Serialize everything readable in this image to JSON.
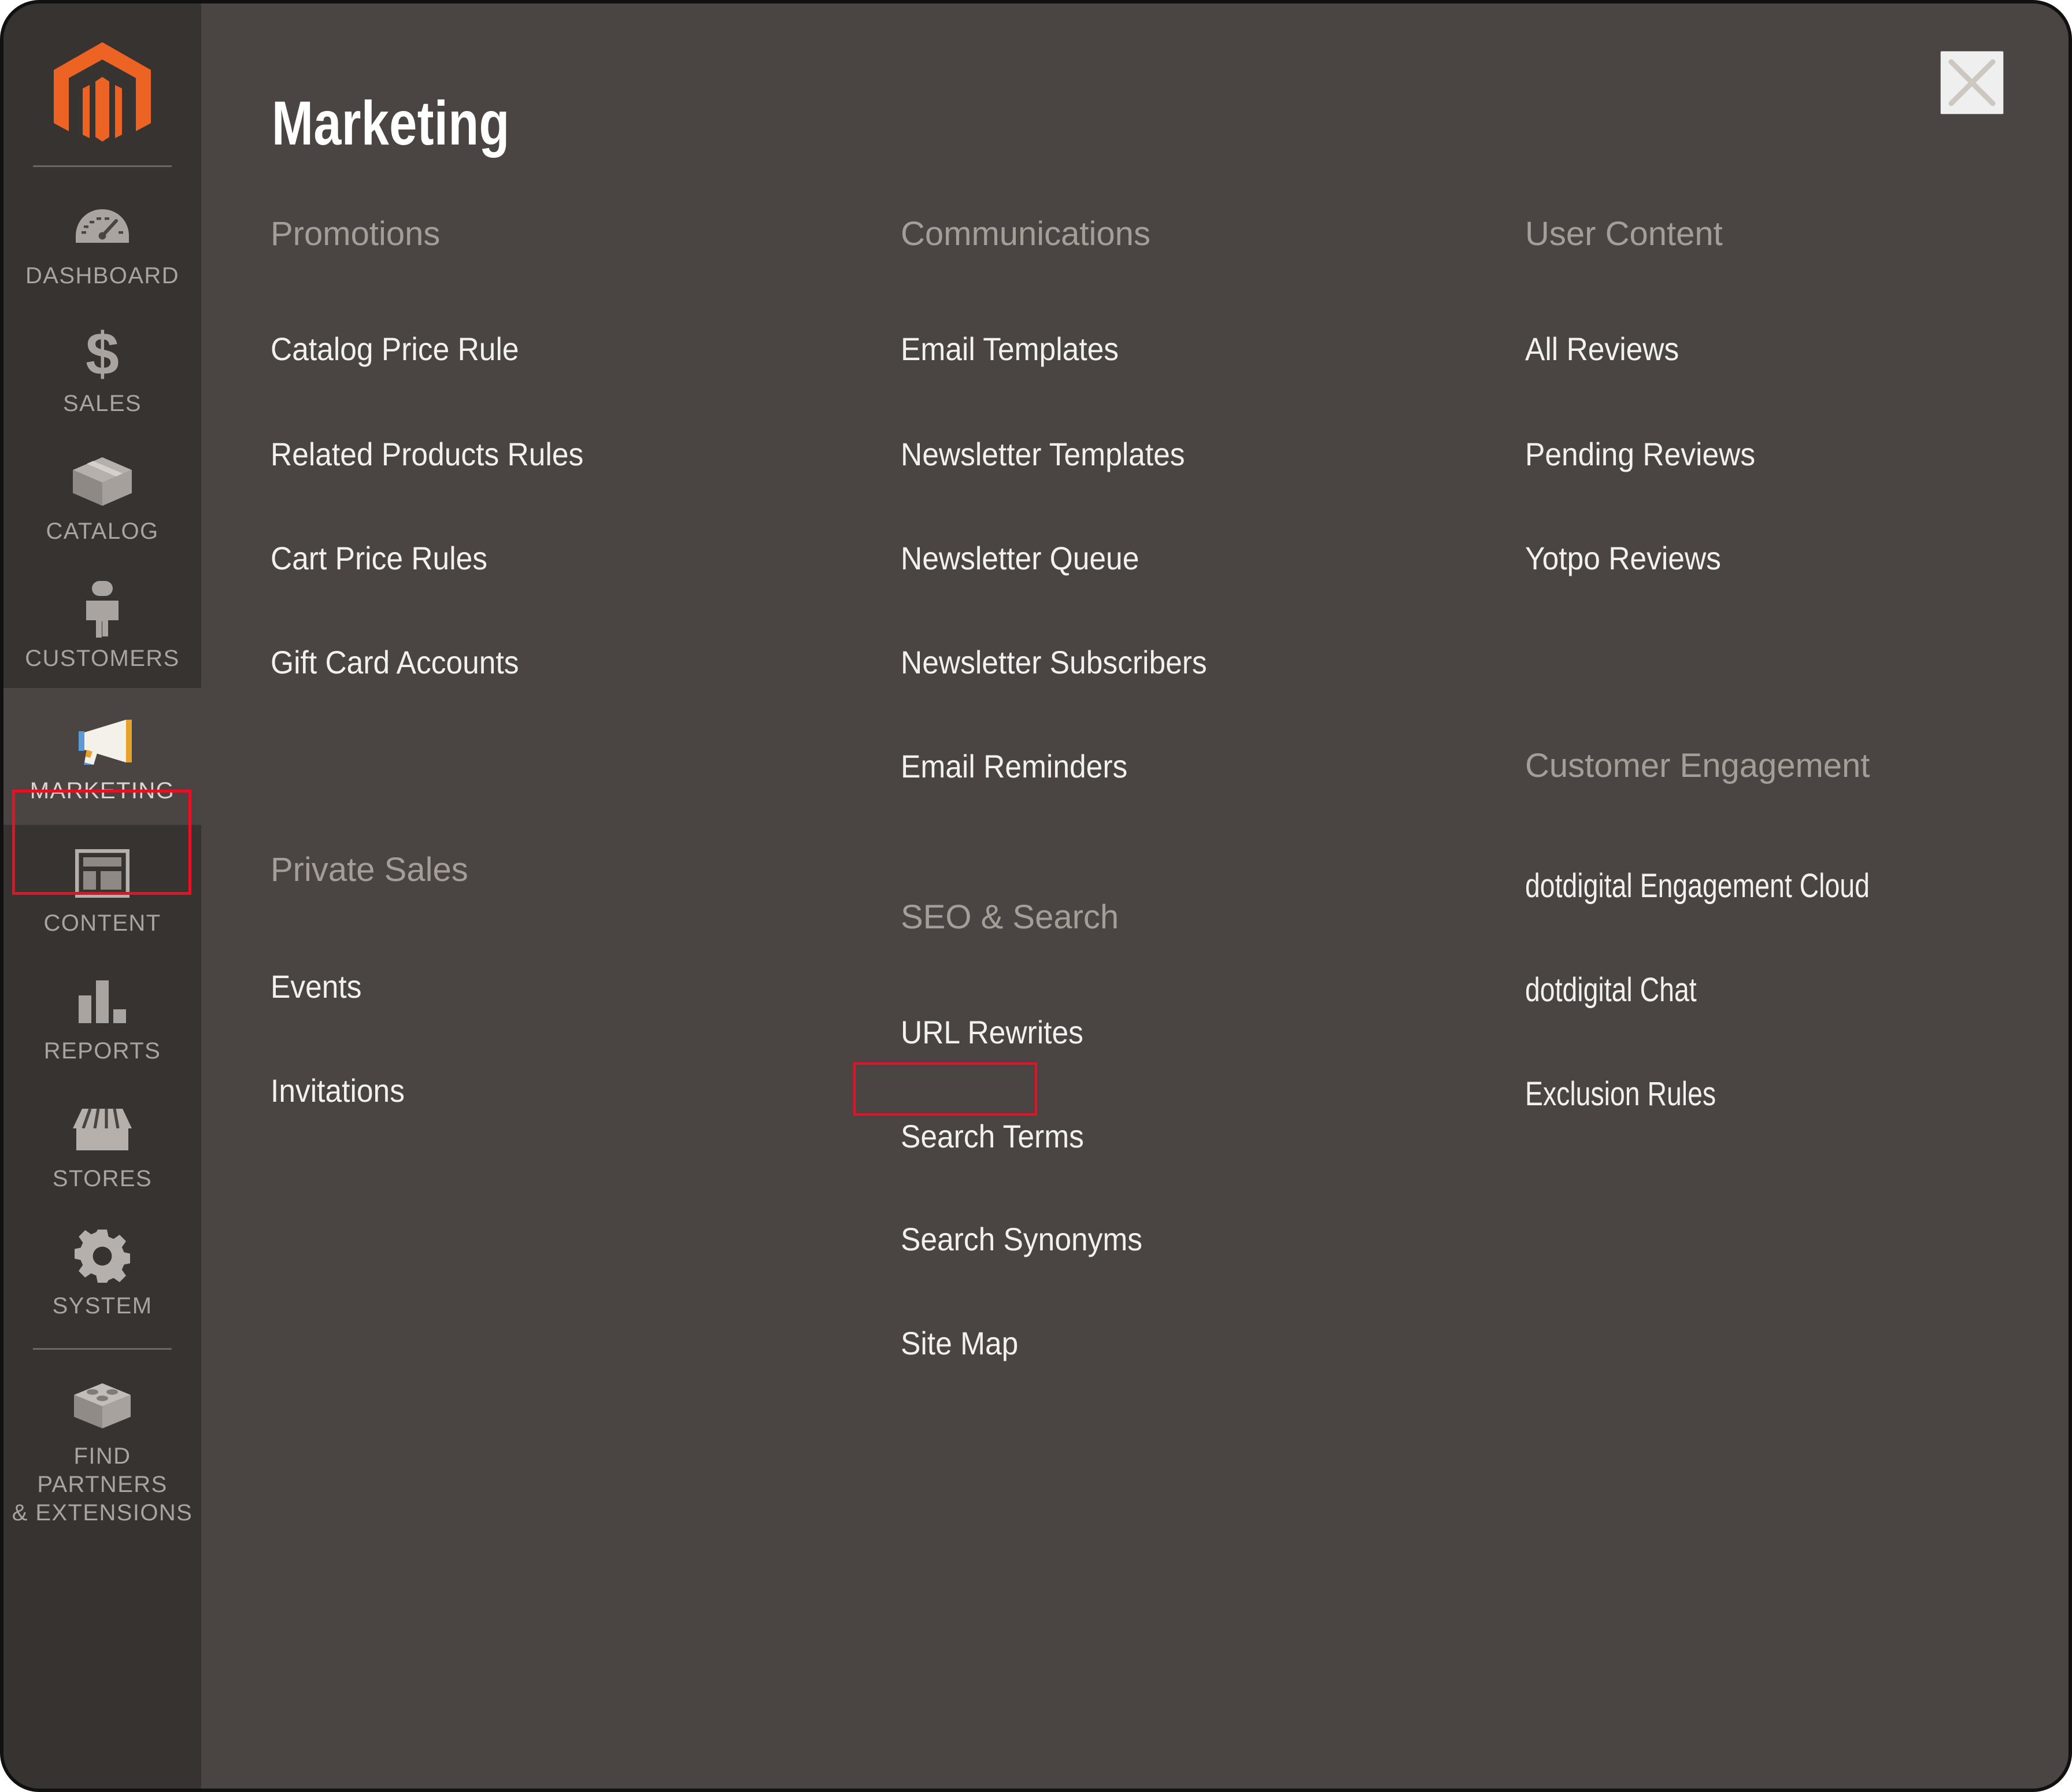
{
  "panel": {
    "title": "Marketing",
    "close_icon": "close-icon"
  },
  "sidebar": {
    "logo_icon": "magento-logo-icon",
    "items": [
      {
        "label": "DASHBOARD",
        "icon": "gauge-icon",
        "active": false
      },
      {
        "label": "SALES",
        "icon": "dollar-icon",
        "active": false
      },
      {
        "label": "CATALOG",
        "icon": "box-icon",
        "active": false
      },
      {
        "label": "CUSTOMERS",
        "icon": "person-icon",
        "active": false
      },
      {
        "label": "MARKETING",
        "icon": "megaphone-icon",
        "active": true
      },
      {
        "label": "CONTENT",
        "icon": "layout-icon",
        "active": false
      },
      {
        "label": "REPORTS",
        "icon": "bar-chart-icon",
        "active": false
      },
      {
        "label": "STORES",
        "icon": "storefront-icon",
        "active": false
      },
      {
        "label": "SYSTEM",
        "icon": "gear-icon",
        "active": false
      },
      {
        "label": "FIND PARTNERS\n& EXTENSIONS",
        "icon": "brick-icon",
        "active": false
      }
    ]
  },
  "menu": {
    "columns": [
      {
        "groups": [
          {
            "heading": "Promotions",
            "items": [
              "Catalog Price Rule",
              "Related Products Rules",
              "Cart Price Rules",
              "Gift Card Accounts"
            ]
          },
          {
            "heading": "Private Sales",
            "items": [
              "Events",
              "Invitations"
            ]
          }
        ]
      },
      {
        "groups": [
          {
            "heading": "Communications",
            "items": [
              "Email Templates",
              "Newsletter Templates",
              "Newsletter Queue",
              "Newsletter Subscribers",
              "Email Reminders"
            ]
          },
          {
            "heading": "SEO & Search",
            "items": [
              "URL Rewrites",
              "Search Terms",
              "Search Synonyms",
              "Site Map"
            ]
          }
        ]
      },
      {
        "groups": [
          {
            "heading": "User Content",
            "items": [
              "All Reviews",
              "Pending Reviews",
              "Yotpo Reviews"
            ]
          },
          {
            "heading": "Customer Engagement",
            "items": [
              "dotdigital Engagement Cloud",
              "dotdigital Chat",
              "Exclusion Rules"
            ]
          }
        ]
      }
    ]
  },
  "highlights": {
    "sidebar_target": "MARKETING",
    "menu_target": "URL Rewrites",
    "color": "#e81123"
  },
  "colors": {
    "panel_bg": "#4a4542",
    "sidebar_bg": "#373330",
    "logo_orange": "#ec6324",
    "link_text": "#f3f1ef",
    "heading_text": "#a59d98",
    "nav_label": "#a9a4a0"
  }
}
